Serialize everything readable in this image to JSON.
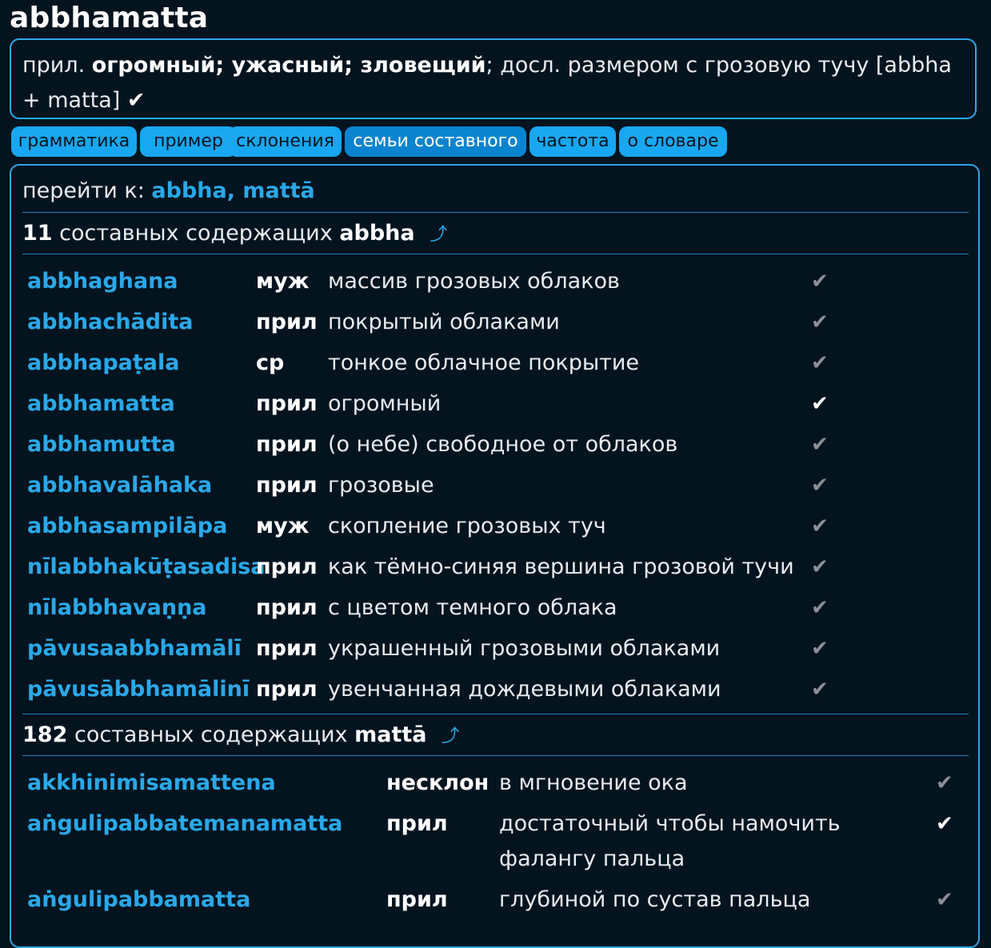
{
  "headword": "abbhamatta",
  "summary": {
    "pos": "прил.",
    "meaning_bold": "огромный; ужасный; зловещий",
    "rest": "; досл. размером с грозовую тучу [abbha + matta]",
    "check": "✔"
  },
  "tabs": [
    {
      "label": "грамматика"
    },
    {
      "label": "пример"
    },
    {
      "label": "склонения"
    },
    {
      "label": "семьи составного"
    },
    {
      "label": "частота"
    },
    {
      "label": "о словаре"
    }
  ],
  "family": {
    "jump_label": "перейти к:",
    "jump_links": "abbha, mattā",
    "sections": [
      {
        "count": "11",
        "title_text": "составных содержащих",
        "root": "abbha",
        "up_icon": "⤴",
        "rows": [
          {
            "word": "abbhaghana",
            "pos": "муж",
            "meaning": "массив грозовых облаков",
            "check": "✔",
            "check_color": "gray"
          },
          {
            "word": "abbhachādita",
            "pos": "прил",
            "meaning": "покрытый облаками",
            "check": "✔",
            "check_color": "gray"
          },
          {
            "word": "abbhapaṭala",
            "pos": "ср",
            "meaning": "тонкое облачное покрытие",
            "check": "✔",
            "check_color": "gray"
          },
          {
            "word": "abbhamatta",
            "pos": "прил",
            "meaning": "огромный",
            "check": "✔",
            "check_color": "white"
          },
          {
            "word": "abbhamutta",
            "pos": "прил",
            "meaning": "(о небе) свободное от облаков",
            "check": "✔",
            "check_color": "gray"
          },
          {
            "word": "abbhavalāhaka",
            "pos": "прил",
            "meaning": "грозовые",
            "check": "✔",
            "check_color": "gray"
          },
          {
            "word": "abbhasampilāpa",
            "pos": "муж",
            "meaning": "скопление грозовых туч",
            "check": "✔",
            "check_color": "gray"
          },
          {
            "word": "nīlabbhakūṭasadisa",
            "pos": "прил",
            "meaning": "как тёмно-синяя вершина грозовой тучи",
            "check": "✔",
            "check_color": "gray"
          },
          {
            "word": "nīlabbhavaṇṇa",
            "pos": "прил",
            "meaning": "с цветом темного облака",
            "check": "✔",
            "check_color": "gray"
          },
          {
            "word": "pāvusaabbhamālī",
            "pos": "прил",
            "meaning": "украшенный грозовыми облаками",
            "check": "✔",
            "check_color": "gray"
          },
          {
            "word": "pāvusābbhamālinī",
            "pos": "прил",
            "meaning": "увенчанная дождевыми облаками",
            "check": "✔",
            "check_color": "gray"
          }
        ]
      },
      {
        "count": "182",
        "title_text": "составных содержащих",
        "root": "mattā",
        "up_icon": "⤴",
        "rows": [
          {
            "word": "akkhinimisamattena",
            "pos": "несклон",
            "meaning": "в мгновение ока",
            "check": "✔",
            "check_color": "gray"
          },
          {
            "word": "aṅgulipabbatemanamatta",
            "pos": "прил",
            "meaning": "достаточный чтобы намочить фалангу пальца",
            "check": "✔",
            "check_color": "white"
          },
          {
            "word": "aṅgulipabbamatta",
            "pos": "прил",
            "meaning": "глубиной по сустав пальца",
            "check": "✔",
            "check_color": "gray"
          }
        ]
      }
    ]
  },
  "colors": {
    "background": "#04141f",
    "accent": "#2aa8e8",
    "tab": "#18a7f0",
    "tab_active": "#0a84d0"
  }
}
